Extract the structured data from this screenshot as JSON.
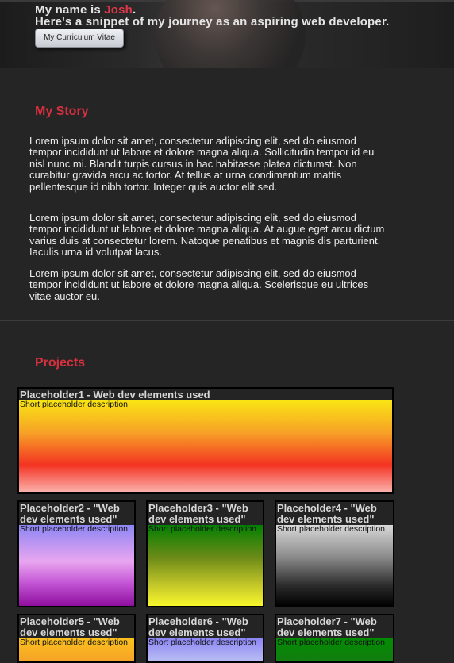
{
  "header": {
    "intro_prefix": "My name is ",
    "name": "Josh",
    "intro_suffix": ".",
    "tagline": "Here's a snippet of my journey as an aspiring web developer.",
    "cv_button_label": "My Curriculum Vitae"
  },
  "story": {
    "title": "My Story",
    "paragraphs": [
      "Lorem ipsum dolor sit amet, consectetur adipiscing elit, sed do eiusmod tempor incididunt ut labore et dolore magna aliqua. Sollicitudin tempor id eu nisl nunc mi. Blandit turpis cursus in hac habitasse platea dictumst. Non curabitur gravida arcu ac tortor. At tellus at urna condimentum mattis pellentesque id nibh tortor. Integer quis auctor elit sed.",
      "Lorem ipsum dolor sit amet, consectetur adipiscing elit, sed do eiusmod tempor incididunt ut labore et dolore magna aliqua. At augue eget arcu dictum varius duis at consectetur lorem. Natoque penatibus et magnis dis parturient. Iaculis urna id volutpat lacus.",
      "Lorem ipsum dolor sit amet, consectetur adipiscing elit, sed do eiusmod tempor incididunt ut labore et dolore magna aliqua. Scelerisque eu ultrices vitae auctor eu."
    ]
  },
  "projects": {
    "title": "Projects",
    "items": [
      {
        "title": "Placeholder1 - Web dev elements used",
        "description": "Short placeholder description"
      },
      {
        "title": "Placeholder2 - \"Web dev elements used\"",
        "description": "Short placeholder description"
      },
      {
        "title": "Placeholder3 - \"Web dev elements used\"",
        "description": "Short placeholder description"
      },
      {
        "title": "Placeholder4 - \"Web dev elements used\"",
        "description": "Short placeholder description"
      },
      {
        "title": "Placeholder5 - \"Web dev elements used\"",
        "description": "Short placeholder description"
      },
      {
        "title": "Placeholder6 - \"Web dev elements used\"",
        "description": "Short placeholder description"
      },
      {
        "title": "Placeholder7 - \"Web dev elements used\"",
        "description": "Short placeholder description"
      }
    ]
  },
  "colors": {
    "background": "#252525",
    "accent": "#d6303f",
    "text": "#e8e8e8"
  }
}
